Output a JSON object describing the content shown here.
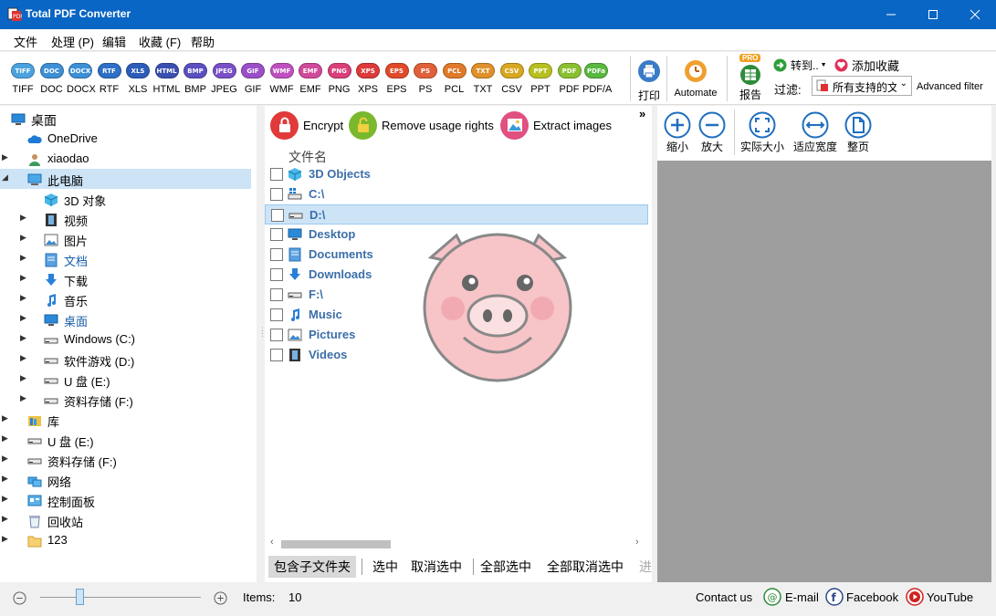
{
  "window": {
    "title": "Total PDF Converter"
  },
  "menu": [
    "文件",
    "处理 (P)",
    "编辑",
    "收藏 (F)",
    "帮助"
  ],
  "formats": [
    {
      "badge": "TIFF",
      "label": "TIFF",
      "color": "#4aa3df"
    },
    {
      "badge": "DOC",
      "label": "DOC",
      "color": "#3d8fd6"
    },
    {
      "badge": "DOCX",
      "label": "DOCX",
      "color": "#3d8fd6"
    },
    {
      "badge": "RTF",
      "label": "RTF",
      "color": "#2f6fc6"
    },
    {
      "badge": "XLS",
      "label": "XLS",
      "color": "#2d5db8"
    },
    {
      "badge": "HTML",
      "label": "HTML",
      "color": "#3a4fb0"
    },
    {
      "badge": "BMP",
      "label": "BMP",
      "color": "#5a4fc0"
    },
    {
      "badge": "JPEG",
      "label": "JPEG",
      "color": "#7a4fc8"
    },
    {
      "badge": "GIF",
      "label": "GIF",
      "color": "#9a4fc8"
    },
    {
      "badge": "WMF",
      "label": "WMF",
      "color": "#c050c0"
    },
    {
      "badge": "EMF",
      "label": "EMF",
      "color": "#d04a9a"
    },
    {
      "badge": "PNG",
      "label": "PNG",
      "color": "#d9407a"
    },
    {
      "badge": "XPS",
      "label": "XPS",
      "color": "#dd3a3a"
    },
    {
      "badge": "EPS",
      "label": "EPS",
      "color": "#e04a2a"
    },
    {
      "badge": "PS",
      "label": "PS",
      "color": "#e0603a"
    },
    {
      "badge": "PCL",
      "label": "PCL",
      "color": "#e07a2a"
    },
    {
      "badge": "TXT",
      "label": "TXT",
      "color": "#e0902a"
    },
    {
      "badge": "CSV",
      "label": "CSV",
      "color": "#d8a820"
    },
    {
      "badge": "PPT",
      "label": "PPT",
      "color": "#b8c020"
    },
    {
      "badge": "PDF",
      "label": "PDF",
      "color": "#8ac030"
    },
    {
      "badge": "PDFa",
      "label": "PDF/A",
      "color": "#5ab840"
    }
  ],
  "toolbar": {
    "print": "打印",
    "automate": "Automate",
    "report": "报告",
    "pro_badge": "PRO",
    "goto": "转到..",
    "add_favorite": "添加收藏",
    "filter_label": "过滤:",
    "filter_value": "所有支持的文",
    "advanced_filter": "Advanced filter"
  },
  "tree": [
    {
      "label": "桌面",
      "icon": "desktop-icon",
      "level": 0,
      "arrow": ""
    },
    {
      "label": "OneDrive",
      "icon": "cloud-icon",
      "level": 1,
      "arrow": ""
    },
    {
      "label": "xiaodao",
      "icon": "user-icon",
      "level": 1,
      "arrow": "▶"
    },
    {
      "label": "此电脑",
      "icon": "computer-icon",
      "level": 1,
      "arrow": "◢",
      "selected": true
    },
    {
      "label": "3D 对象",
      "icon": "cube-icon",
      "level": 2,
      "arrow": ""
    },
    {
      "label": "视频",
      "icon": "film-icon",
      "level": 2,
      "arrow": "▶"
    },
    {
      "label": "图片",
      "icon": "picture-icon",
      "level": 2,
      "arrow": "▶"
    },
    {
      "label": "文档",
      "icon": "document-icon",
      "level": 2,
      "arrow": "▶"
    },
    {
      "label": "下载",
      "icon": "download-icon",
      "level": 2,
      "arrow": "▶"
    },
    {
      "label": "音乐",
      "icon": "music-icon",
      "level": 2,
      "arrow": "▶"
    },
    {
      "label": "桌面",
      "icon": "desktop-icon",
      "level": 2,
      "arrow": "▶"
    },
    {
      "label": "Windows (C:)",
      "icon": "drive-icon",
      "level": 2,
      "arrow": "▶"
    },
    {
      "label": "软件游戏 (D:)",
      "icon": "drive-icon",
      "level": 2,
      "arrow": "▶"
    },
    {
      "label": "U 盘 (E:)",
      "icon": "drive-icon",
      "level": 2,
      "arrow": "▶"
    },
    {
      "label": "资料存储 (F:)",
      "icon": "drive-icon",
      "level": 2,
      "arrow": "▶"
    },
    {
      "label": "库",
      "icon": "library-icon",
      "level": 1,
      "arrow": "▶"
    },
    {
      "label": "U 盘 (E:)",
      "icon": "drive-icon",
      "level": 1,
      "arrow": "▶"
    },
    {
      "label": "资料存储 (F:)",
      "icon": "drive-icon",
      "level": 1,
      "arrow": "▶"
    },
    {
      "label": "网络",
      "icon": "network-icon",
      "level": 1,
      "arrow": "▶"
    },
    {
      "label": "控制面板",
      "icon": "control-panel-icon",
      "level": 1,
      "arrow": "▶"
    },
    {
      "label": "回收站",
      "icon": "recycle-bin-icon",
      "level": 1,
      "arrow": "▶"
    },
    {
      "label": "123",
      "icon": "folder-icon",
      "level": 1,
      "arrow": "▶"
    }
  ],
  "actions": {
    "encrypt": "Encrypt",
    "remove_rights": "Remove usage rights",
    "extract_images": "Extract images",
    "more": "»"
  },
  "file_list": {
    "column_name": "文件名",
    "items": [
      {
        "name": "3D Objects",
        "icon": "cube-icon"
      },
      {
        "name": "C:\\",
        "icon": "windows-drive-icon"
      },
      {
        "name": "D:\\",
        "icon": "drive-icon",
        "selected": true
      },
      {
        "name": "Desktop",
        "icon": "desktop-icon"
      },
      {
        "name": "Documents",
        "icon": "document-icon"
      },
      {
        "name": "Downloads",
        "icon": "download-icon"
      },
      {
        "name": "F:\\",
        "icon": "drive-icon"
      },
      {
        "name": "Music",
        "icon": "music-icon"
      },
      {
        "name": "Pictures",
        "icon": "picture-icon"
      },
      {
        "name": "Videos",
        "icon": "film-icon"
      }
    ]
  },
  "bottom_actions": [
    "包含子文件夹",
    "选中",
    "取消选中",
    "全部选中",
    "全部取消选中",
    "进"
  ],
  "zoom_tools": [
    "缩小",
    "放大",
    "实际大小",
    "适应宽度",
    "整页"
  ],
  "status": {
    "items_label": "Items:",
    "items_count": "10",
    "contact": "Contact us",
    "email": "E-mail",
    "facebook": "Facebook",
    "youtube": "YouTube"
  }
}
